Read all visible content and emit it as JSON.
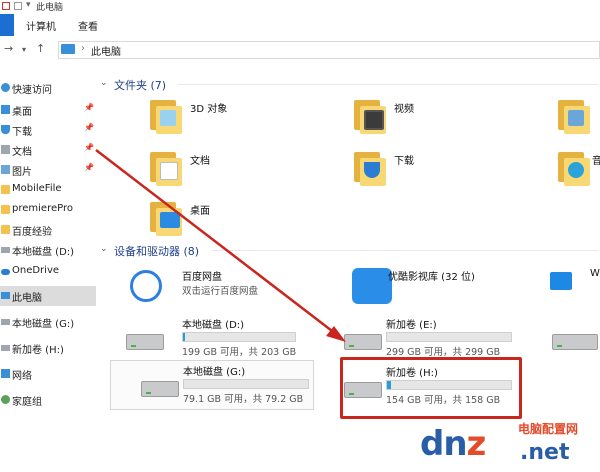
{
  "window": {
    "title": "此电脑"
  },
  "ribbon": {
    "file_label": "",
    "tabs": [
      "计算机",
      "查看"
    ]
  },
  "address": {
    "crumb": "此电脑",
    "separator": "›"
  },
  "sidebar": {
    "items": [
      {
        "label": "快速访问",
        "icon": "star-icon",
        "pinned": false
      },
      {
        "label": "桌面",
        "icon": "desktop-icon",
        "pinned": true
      },
      {
        "label": "下载",
        "icon": "download-icon",
        "pinned": true
      },
      {
        "label": "文档",
        "icon": "document-icon",
        "pinned": true
      },
      {
        "label": "图片",
        "icon": "picture-icon",
        "pinned": true
      },
      {
        "label": "MobileFile",
        "icon": "folder-icon",
        "pinned": false
      },
      {
        "label": "premierePro",
        "icon": "folder-icon",
        "pinned": false
      },
      {
        "label": "百度经验",
        "icon": "folder-icon",
        "pinned": false
      },
      {
        "label": "本地磁盘 (D:)",
        "icon": "drive-icon",
        "pinned": false
      },
      {
        "label": "OneDrive",
        "icon": "cloud-icon",
        "pinned": false
      },
      {
        "label": "此电脑",
        "icon": "computer-icon",
        "pinned": false,
        "selected": true
      },
      {
        "label": "本地磁盘 (G:)",
        "icon": "drive-icon",
        "pinned": false
      },
      {
        "label": "新加卷 (H:)",
        "icon": "drive-icon",
        "pinned": false
      },
      {
        "label": "网络",
        "icon": "network-icon",
        "pinned": false
      },
      {
        "label": "家庭组",
        "icon": "homegroup-icon",
        "pinned": false
      }
    ],
    "pin_glyph": "📌"
  },
  "folders_section": {
    "label": "文件夹 (7)"
  },
  "folders": [
    {
      "label": "3D 对象",
      "icon": "3d-objects-icon"
    },
    {
      "label": "视频",
      "icon": "video-icon"
    },
    {
      "label": "",
      "icon": "pictures-folder-icon"
    },
    {
      "label": "文档",
      "icon": "documents-folder-icon"
    },
    {
      "label": "下载",
      "icon": "downloads-folder-icon"
    },
    {
      "label": "音",
      "icon": "music-folder-icon"
    },
    {
      "label": "桌面",
      "icon": "desktop-folder-icon"
    }
  ],
  "devices_section": {
    "label": "设备和驱动器 (8)"
  },
  "apps": [
    {
      "label": "百度网盘",
      "sub": "双击运行百度网盘",
      "icon": "baidu-netdisk-icon",
      "color": "#2e7fe0"
    },
    {
      "label": "优酷影视库 (32 位)",
      "sub": "",
      "icon": "youku-icon",
      "color": "#2a8ee8"
    },
    {
      "label": "W",
      "sub": "",
      "icon": "windows-drive-icon",
      "color": "#1e88e5"
    }
  ],
  "drives": [
    {
      "label": "本地磁盘 (D:)",
      "free": "199 GB 可用，共 203 GB",
      "used_fraction": 0.02
    },
    {
      "label": "新加卷 (E:)",
      "free": "299 GB 可用，共 299 GB",
      "used_fraction": 0.0
    },
    {
      "label": "本地磁盘 (G:)",
      "free": "79.1 GB 可用，共 79.2 GB",
      "used_fraction": 0.0
    },
    {
      "label": "新加卷 (H:)",
      "free": "154 GB 可用，共 158 GB",
      "used_fraction": 0.03
    }
  ],
  "colors": {
    "accent": "#1a6fd1",
    "highlight": "#c9261f",
    "bar": "#26a0da"
  },
  "watermark": {
    "brand": "dnpz.net",
    "brand_main": "dn",
    "brand_z": "z",
    "tagline": "电脑配置网",
    "domain": ".net"
  }
}
